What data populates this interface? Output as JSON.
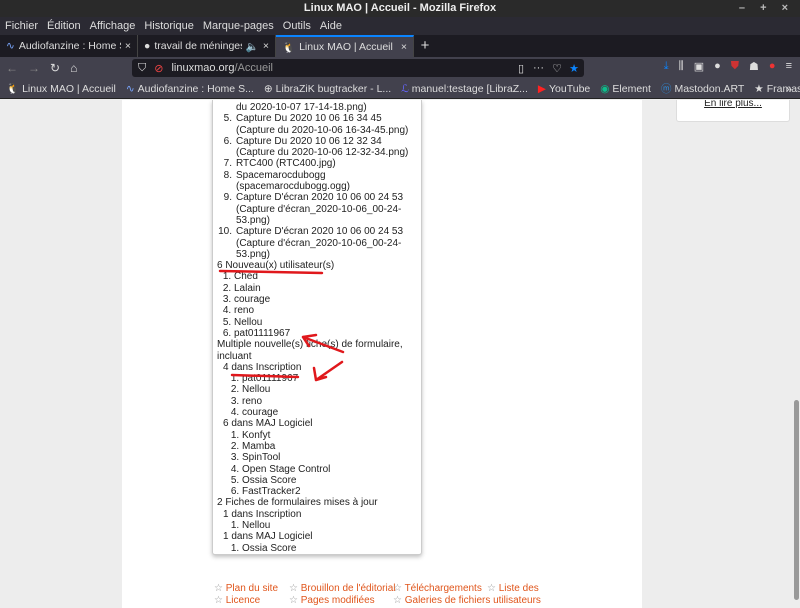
{
  "window": {
    "title": "Linux MAO | Accueil - Mozilla Firefox",
    "controls": "– + ×"
  },
  "menu": [
    "Fichier",
    "Édition",
    "Affichage",
    "Historique",
    "Marque-pages",
    "Outils",
    "Aide"
  ],
  "tabs": [
    {
      "label": "Audiofanzine : Home Stu"
    },
    {
      "label": "travail de méninges! -"
    },
    {
      "label": "Linux MAO | Accueil"
    }
  ],
  "url": {
    "domain": "linuxmao.org",
    "path": "/Accueil"
  },
  "bookmarks": [
    "Linux MAO | Accueil",
    "Audiofanzine : Home S...",
    "LibraZiK bugtracker - L...",
    "manuel:testage [LibraZ...",
    "YouTube",
    "Element",
    "Mastodon.ART",
    "Framasphere*"
  ],
  "sidebar": {
    "read_more": "En lire plus..."
  },
  "popup": {
    "top_partial": "du 2020-10-07 17-14-18.png)",
    "files": [
      {
        "n": "5.",
        "text": "Capture Du 2020 10 06 16 34 45 (Capture du 2020-10-06 16-34-45.png)"
      },
      {
        "n": "6.",
        "text": "Capture Du 2020 10 06 12 32 34 (Capture du 2020-10-06 12-32-34.png)"
      },
      {
        "n": "7.",
        "text": "RTC400 (RTC400.jpg)"
      },
      {
        "n": "8.",
        "text": "Spacemarocdubogg (spacemarocdubogg.ogg)"
      },
      {
        "n": "9.",
        "text": "Capture D'écran 2020 10 06 00 24 53 (Capture d'écran_2020-10-06_00-24-53.png)"
      },
      {
        "n": "10.",
        "text": "Capture D'écran 2020 10 06 00 24 53 (Capture d'écran_2020-10-06_00-24-53.png)"
      }
    ],
    "new_users_heading": "6 Nouveau(x) utilisateur(s)",
    "new_users": [
      "Ched",
      "Lalain",
      "courage",
      "reno",
      "Nellou",
      "pat01111967"
    ],
    "forms_heading": "Multiple nouvelle(s) fiche(s) de formulaire, incluant",
    "inscription_heading": "4 dans Inscription",
    "inscription": [
      "pat01111967",
      "Nellou",
      "reno",
      "courage"
    ],
    "maj_heading": "6 dans MAJ Logiciel",
    "maj": [
      "Konfyt",
      "Mamba",
      "SpinTool",
      "Open Stage Control",
      "Ossia Score",
      "FastTracker2"
    ],
    "updated_heading": "2 Fiches de formulaires mises à jour",
    "updated_inscription_heading": "1 dans Inscription",
    "updated_inscription": [
      "Nellou"
    ],
    "updated_maj_heading": "1 dans MAJ Logiciel",
    "updated_maj": [
      "Ossia Score"
    ]
  },
  "footer": {
    "row1": [
      "Plan du site",
      "Brouillon de l'éditorial",
      "Téléchargements",
      "Liste des"
    ],
    "row2": [
      "Licence",
      "Pages modifiées",
      "Galeries de fichiers utilisateurs"
    ],
    "star": "☆"
  },
  "colors": {
    "link": "#e0561c",
    "annotation": "#e0181c",
    "accent": "#0a84ff"
  }
}
